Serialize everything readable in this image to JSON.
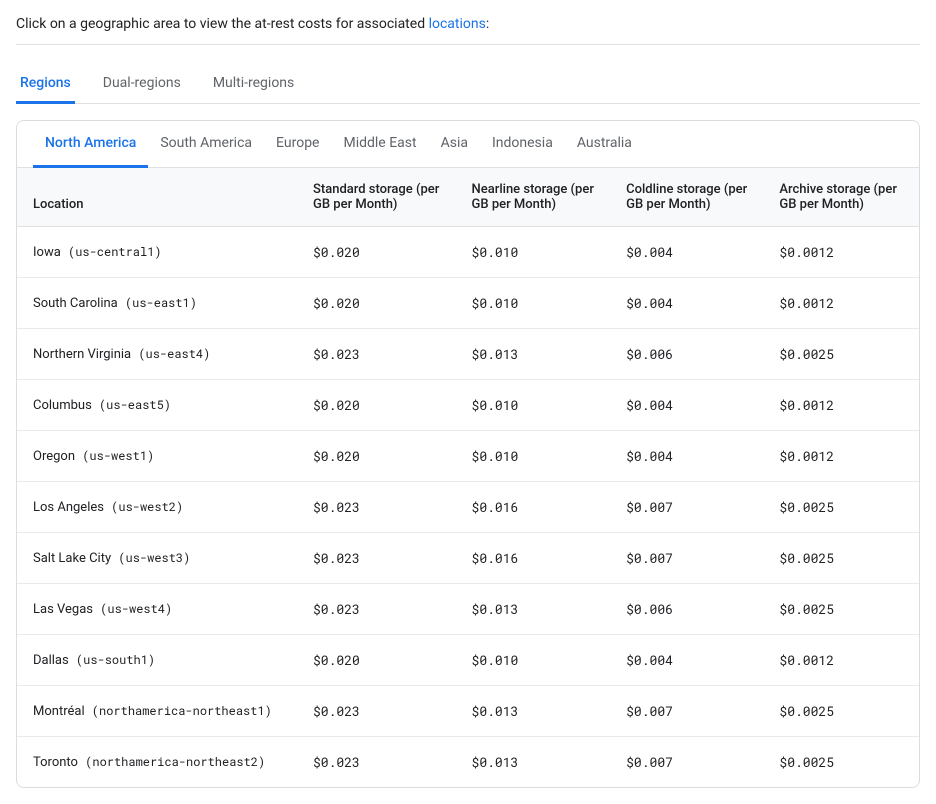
{
  "intro": {
    "text": "Click on a geographic area to view the at-rest costs for associated ",
    "link_label": "locations",
    "suffix": ":"
  },
  "top_tabs": [
    {
      "id": "regions",
      "label": "Regions",
      "active": true
    },
    {
      "id": "dual-regions",
      "label": "Dual-regions",
      "active": false
    },
    {
      "id": "multi-regions",
      "label": "Multi-regions",
      "active": false
    }
  ],
  "geo_tabs": [
    {
      "id": "north-america",
      "label": "North America",
      "active": true
    },
    {
      "id": "south-america",
      "label": "South America",
      "active": false
    },
    {
      "id": "europe",
      "label": "Europe",
      "active": false
    },
    {
      "id": "middle-east",
      "label": "Middle East",
      "active": false
    },
    {
      "id": "asia",
      "label": "Asia",
      "active": false
    },
    {
      "id": "indonesia",
      "label": "Indonesia",
      "active": false
    },
    {
      "id": "australia",
      "label": "Australia",
      "active": false
    }
  ],
  "table": {
    "columns": [
      {
        "id": "location",
        "label": "Location"
      },
      {
        "id": "standard",
        "label": "Standard storage (per GB per Month)"
      },
      {
        "id": "nearline",
        "label": "Nearline storage (per GB per Month)"
      },
      {
        "id": "coldline",
        "label": "Coldline storage (per GB per Month)"
      },
      {
        "id": "archive",
        "label": "Archive storage (per GB per Month)"
      }
    ],
    "rows": [
      {
        "location": "Iowa (us-central1)",
        "standard": "$0.020",
        "nearline": "$0.010",
        "coldline": "$0.004",
        "archive": "$0.0012"
      },
      {
        "location": "South Carolina (us-east1)",
        "standard": "$0.020",
        "nearline": "$0.010",
        "coldline": "$0.004",
        "archive": "$0.0012"
      },
      {
        "location": "Northern Virginia (us-east4)",
        "standard": "$0.023",
        "nearline": "$0.013",
        "coldline": "$0.006",
        "archive": "$0.0025"
      },
      {
        "location": "Columbus (us-east5)",
        "standard": "$0.020",
        "nearline": "$0.010",
        "coldline": "$0.004",
        "archive": "$0.0012"
      },
      {
        "location": "Oregon (us-west1)",
        "standard": "$0.020",
        "nearline": "$0.010",
        "coldline": "$0.004",
        "archive": "$0.0012"
      },
      {
        "location": "Los Angeles (us-west2)",
        "standard": "$0.023",
        "nearline": "$0.016",
        "coldline": "$0.007",
        "archive": "$0.0025"
      },
      {
        "location": "Salt Lake City (us-west3)",
        "standard": "$0.023",
        "nearline": "$0.016",
        "coldline": "$0.007",
        "archive": "$0.0025"
      },
      {
        "location": "Las Vegas (us-west4)",
        "standard": "$0.023",
        "nearline": "$0.013",
        "coldline": "$0.006",
        "archive": "$0.0025"
      },
      {
        "location": "Dallas (us-south1)",
        "standard": "$0.020",
        "nearline": "$0.010",
        "coldline": "$0.004",
        "archive": "$0.0012"
      },
      {
        "location": "Montréal (northamerica-northeast1)",
        "standard": "$0.023",
        "nearline": "$0.013",
        "coldline": "$0.007",
        "archive": "$0.0025"
      },
      {
        "location": "Toronto (northamerica-northeast2)",
        "standard": "$0.023",
        "nearline": "$0.013",
        "coldline": "$0.007",
        "archive": "$0.0025"
      }
    ]
  }
}
